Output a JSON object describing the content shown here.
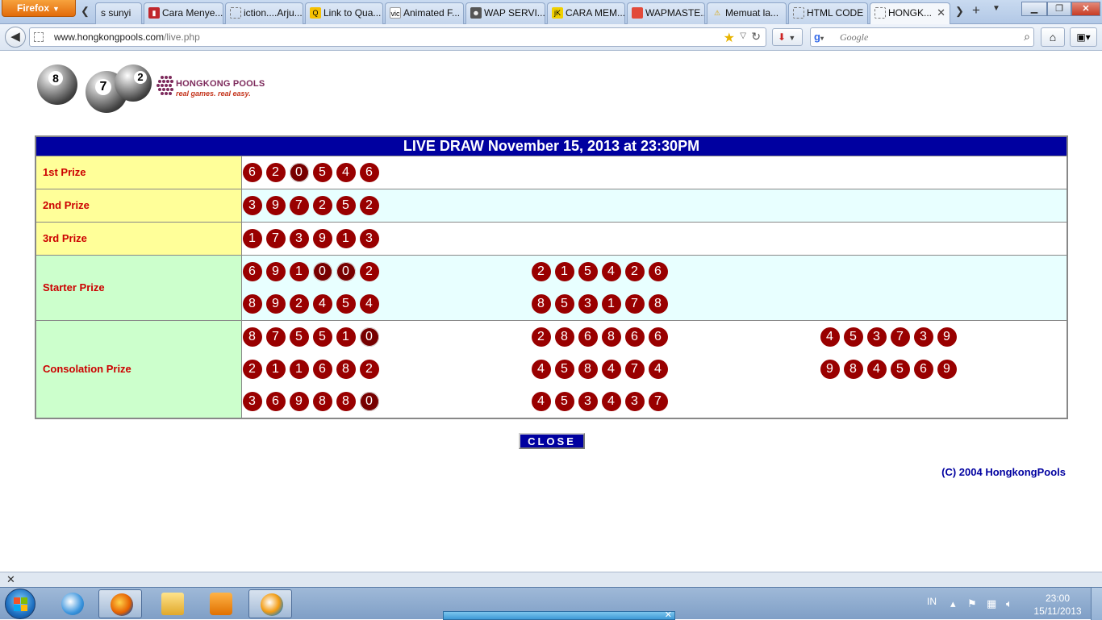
{
  "browser": {
    "app_button": "Firefox",
    "tabs": [
      {
        "label": "s sunyi",
        "icon": ""
      },
      {
        "label": "Cara Menye...",
        "icon": "red"
      },
      {
        "label": "iction....Arju...",
        "icon": "blank"
      },
      {
        "label": "Link to Qua...",
        "icon": "yellow"
      },
      {
        "label": "Animated F...",
        "icon": "vic"
      },
      {
        "label": "WAP SERVI...",
        "icon": "mask"
      },
      {
        "label": "CARA MEM...",
        "icon": "jk"
      },
      {
        "label": "WAPMASTE...",
        "icon": "red-pen"
      },
      {
        "label": "Memuat la...",
        "icon": "warning"
      },
      {
        "label": "HTML CODE",
        "icon": "blank"
      },
      {
        "label": "HONGK...",
        "icon": "blank"
      }
    ],
    "url_host": "www.hongkongpools.com",
    "url_path": "/live.php",
    "search_placeholder": "Google"
  },
  "page": {
    "logo_name": "HONGKONG POOLS",
    "logo_tagline": "real games. real easy.",
    "logo_balls": [
      "8",
      "7",
      "2"
    ],
    "header": "LIVE DRAW  November 15, 2013 at 23:30PM",
    "prizes": [
      {
        "label": "1st Prize",
        "style": "yellow",
        "bg": "white",
        "lines": [
          [
            "620546"
          ]
        ]
      },
      {
        "label": "2nd Prize",
        "style": "yellow",
        "bg": "cyan",
        "lines": [
          [
            "397252"
          ]
        ]
      },
      {
        "label": "3rd Prize",
        "style": "yellow",
        "bg": "white",
        "lines": [
          [
            "173913"
          ]
        ]
      },
      {
        "label": "Starter Prize",
        "style": "green",
        "bg": "cyan",
        "lines": [
          [
            "691002",
            "215426"
          ],
          [
            "892454",
            "853178"
          ]
        ]
      },
      {
        "label": "Consolation Prize",
        "style": "green",
        "bg": "white",
        "lines": [
          [
            "875510",
            "286866",
            "453739"
          ],
          [
            "211682",
            "458474",
            "984569"
          ],
          [
            "369880",
            "453437"
          ]
        ]
      }
    ],
    "close_label": "CLOSE",
    "copyright": "(C) 2004 HongkongPools"
  },
  "taskbar": {
    "language": "IN",
    "time": "23:00",
    "date": "15/11/2013"
  },
  "colors": {
    "header_blue": "#0000a0",
    "ball_red": "#990000",
    "label_red": "#cc0000",
    "yellow_cell": "#ffff99",
    "green_cell": "#ccffcc"
  }
}
